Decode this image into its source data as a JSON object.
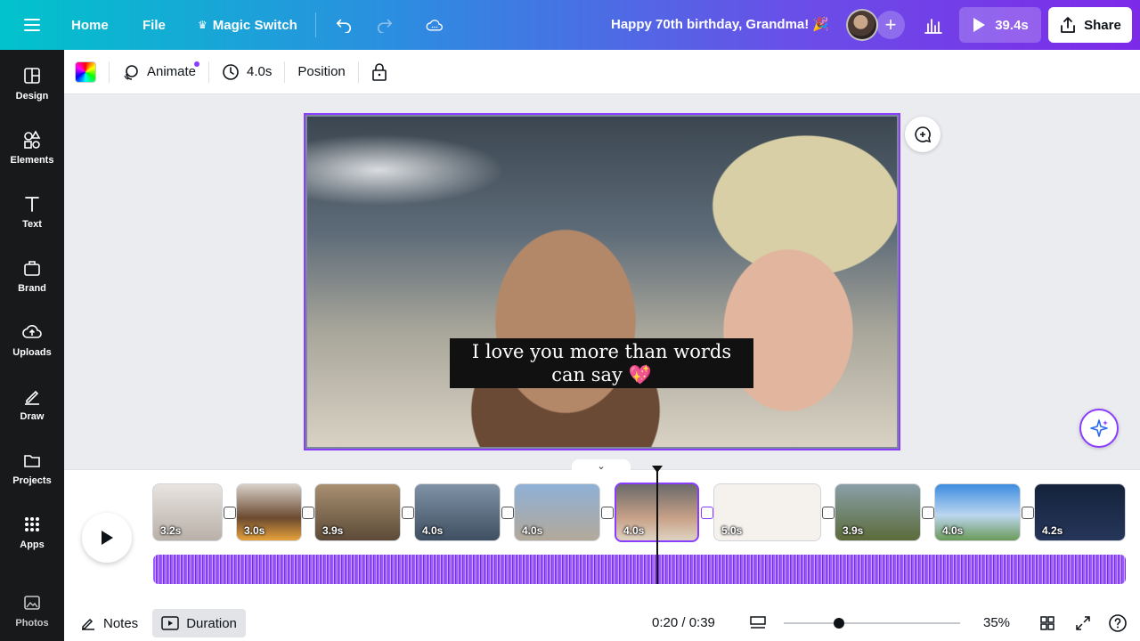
{
  "topbar": {
    "home": "Home",
    "file": "File",
    "magic_switch": "Magic Switch",
    "title": "Happy 70th birthday, Grandma! 🎉",
    "duration": "39.4s",
    "share": "Share"
  },
  "sidebar": {
    "items": [
      {
        "label": "Design",
        "icon": "layout-icon"
      },
      {
        "label": "Elements",
        "icon": "shapes-icon"
      },
      {
        "label": "Text",
        "icon": "text-icon"
      },
      {
        "label": "Brand",
        "icon": "brand-icon"
      },
      {
        "label": "Uploads",
        "icon": "cloud-upload-icon"
      },
      {
        "label": "Draw",
        "icon": "pen-icon"
      },
      {
        "label": "Projects",
        "icon": "folder-icon"
      },
      {
        "label": "Apps",
        "icon": "grid-icon"
      },
      {
        "label": "Photos",
        "icon": "photo-icon"
      }
    ]
  },
  "toolbar": {
    "animate": "Animate",
    "time": "4.0s",
    "position": "Position"
  },
  "canvas": {
    "caption": "I love you more than words can say 💖"
  },
  "timeline": {
    "clips": [
      {
        "dur": "3.2s"
      },
      {
        "dur": "3.0s"
      },
      {
        "dur": "3.9s"
      },
      {
        "dur": "4.0s"
      },
      {
        "dur": "4.0s"
      },
      {
        "dur": "4.0s"
      },
      {
        "dur": "5.0s"
      },
      {
        "dur": "3.9s"
      },
      {
        "dur": "4.0s"
      },
      {
        "dur": "4.2s"
      }
    ],
    "selected_index": 5
  },
  "bottom": {
    "notes": "Notes",
    "duration": "Duration",
    "time": "0:20 / 0:39",
    "zoom": "35%"
  },
  "colors": {
    "accent": "#8b3dff",
    "sidebar_bg": "#18191b"
  }
}
